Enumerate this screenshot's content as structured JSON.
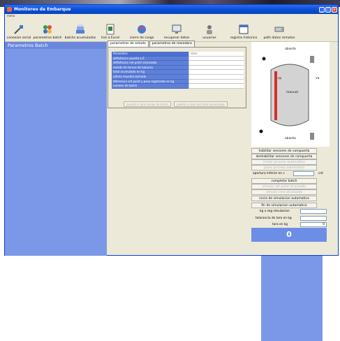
{
  "window": {
    "title": "Monitoreo de Embarque",
    "menu": "menu"
  },
  "toolbar": [
    {
      "label": "conexion serial",
      "icon": "cable-icon"
    },
    {
      "label": "parametros batch",
      "icon": "flower-icon"
    },
    {
      "label": "batchs acumulados",
      "icon": "stack-icon"
    },
    {
      "label": "link a Excel",
      "icon": "excel-icon"
    },
    {
      "label": "cierre de carga",
      "icon": "globe-icon"
    },
    {
      "label": "recuperar datos",
      "icon": "monitor-icon"
    },
    {
      "label": "usuarios",
      "icon": "users-icon"
    },
    {
      "label": "registro historico",
      "icon": "calendar-icon"
    },
    {
      "label": "path datos remotos",
      "icon": "drive-icon"
    }
  ],
  "sidebar": {
    "title": "Parametros Batch"
  },
  "tabs": [
    "parametros de estado",
    "parametros de maniobra"
  ],
  "grid": {
    "header": {
      "key": "Parametro",
      "value": "Valor"
    },
    "rows": [
      "deflafacion puesta a 0",
      "deflafacion set point alcanzado",
      "estado de tornos de balanza",
      "total acumulado en kg",
      "ultima muestra tomada",
      "diferencia set point y peso registrado en kg",
      "numero de batch"
    ],
    "buttons": [
      "puesta a cero tornos de batch",
      "puesta a cero del total acumulado"
    ]
  },
  "tank": {
    "top_state": "abierto",
    "bottom_state": "abierto",
    "mode": "manual",
    "left_tag": "sp",
    "right_tag": "va"
  },
  "controls": {
    "habilitar": "habilitar sensores de compuerta",
    "deshabilitar": "deshabilitar sensores de compuerta",
    "iniciar_auto": "iniciar proceso automatico",
    "parar_auto": "parar proceso automatico",
    "apertura_label": "apertura inferior en c",
    "apertura_unit": "cnt",
    "completar": "completar batch",
    "simular_set": "simular set point alcanzado",
    "simular_cero": "simular cero alcanzado",
    "inicio_sim": "inicio de simulacion automatica",
    "fin_sim": "fin de simulacion automatica",
    "kg_seg_label": "kg x seg simulacion",
    "tolerancia_label": "tolerancia de tara en kg",
    "tara_label": "tara en kg",
    "tara_value": "0",
    "display_value": "0"
  },
  "colors": {
    "accent": "#7b98e8",
    "title": "#0a4fd6",
    "grid_key": "#5f80d8",
    "tank_bar": "#d72f2f"
  }
}
